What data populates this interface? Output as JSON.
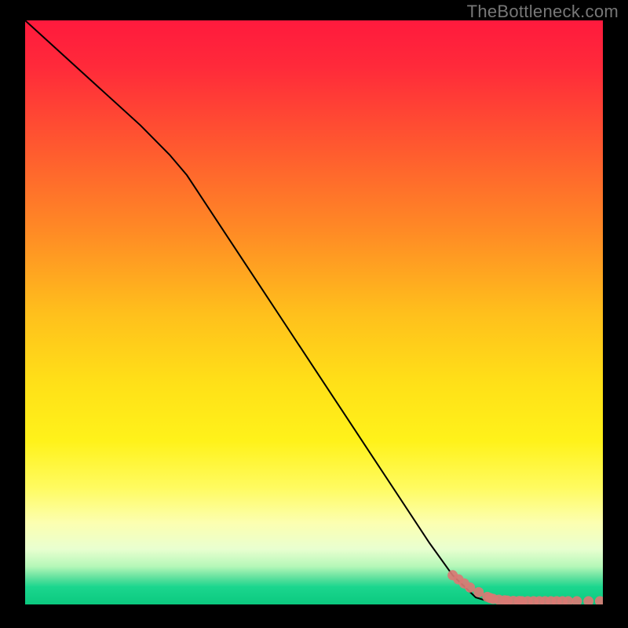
{
  "watermark": "TheBottleneck.com",
  "chart_data": {
    "type": "line",
    "title": "",
    "xlabel": "",
    "ylabel": "",
    "xlim": [
      0,
      100
    ],
    "ylim": [
      0,
      100
    ],
    "grid": false,
    "legend": false,
    "background": {
      "type": "vertical-gradient",
      "stops": [
        {
          "pos": 0.0,
          "color": "#ff1a3d"
        },
        {
          "pos": 0.08,
          "color": "#ff2a3a"
        },
        {
          "pos": 0.22,
          "color": "#ff5a2f"
        },
        {
          "pos": 0.36,
          "color": "#ff8a25"
        },
        {
          "pos": 0.5,
          "color": "#ffbf1c"
        },
        {
          "pos": 0.62,
          "color": "#ffe018"
        },
        {
          "pos": 0.72,
          "color": "#fff21a"
        },
        {
          "pos": 0.8,
          "color": "#fffb60"
        },
        {
          "pos": 0.86,
          "color": "#fcffb0"
        },
        {
          "pos": 0.905,
          "color": "#e9ffd0"
        },
        {
          "pos": 0.935,
          "color": "#b5f7b8"
        },
        {
          "pos": 0.955,
          "color": "#5de09d"
        },
        {
          "pos": 0.97,
          "color": "#1bd68e"
        },
        {
          "pos": 1.0,
          "color": "#0bc97f"
        }
      ]
    },
    "series": [
      {
        "name": "curve",
        "style": "line",
        "color": "#000000",
        "x": [
          0,
          5,
          10,
          15,
          20,
          25,
          28,
          30,
          35,
          40,
          45,
          50,
          55,
          60,
          65,
          70,
          74,
          78,
          80
        ],
        "y": [
          100,
          95.5,
          91,
          86.5,
          82,
          77,
          73.5,
          70.5,
          63,
          55.5,
          48,
          40.5,
          33,
          25.5,
          18,
          10.5,
          5,
          1.2,
          0.6
        ]
      },
      {
        "name": "scatter-points",
        "style": "scatter",
        "color": "#d97a74",
        "x": [
          74,
          75,
          76,
          77,
          78.5,
          80,
          80.5,
          81,
          82,
          83,
          83.5,
          84.5,
          85.5,
          86,
          87,
          88,
          89,
          90,
          91,
          92,
          93,
          94,
          95.5,
          97.5,
          99.5
        ],
        "y": [
          5.0,
          4.3,
          3.6,
          2.9,
          2.1,
          1.3,
          1.1,
          0.95,
          0.8,
          0.7,
          0.65,
          0.6,
          0.58,
          0.56,
          0.55,
          0.55,
          0.55,
          0.55,
          0.55,
          0.55,
          0.55,
          0.55,
          0.55,
          0.55,
          0.55
        ]
      }
    ]
  }
}
